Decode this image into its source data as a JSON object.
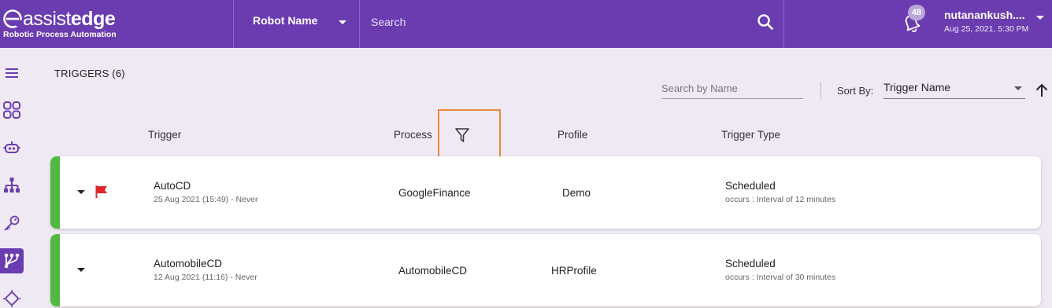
{
  "header": {
    "logo_assist": "assist",
    "logo_edge": "edge",
    "logo_subtitle": "Robotic Process Automation",
    "robot_select_label": "Robot Name",
    "search_placeholder": "Search",
    "notification_count": "48",
    "user_name": "nutanankush....",
    "user_datetime": "Aug 25, 2021, 5:30 PM"
  },
  "sidebar": {
    "items": [
      {
        "icon": "menu-icon"
      },
      {
        "icon": "dashboard-icon"
      },
      {
        "icon": "robot-icon"
      },
      {
        "icon": "hierarchy-icon"
      },
      {
        "icon": "key-icon"
      },
      {
        "icon": "workflow-icon",
        "active": true
      },
      {
        "icon": "chip-icon"
      }
    ]
  },
  "main": {
    "title": "TRIGGERS (6)",
    "search_by_name_placeholder": "Search by Name",
    "sort_by_label": "Sort By:",
    "sort_by_value": "Trigger Name",
    "columns": {
      "trigger": "Trigger",
      "process": "Process",
      "profile": "Profile",
      "trigger_type": "Trigger Type"
    },
    "rows": [
      {
        "name": "AutoCD",
        "date": "25 Aug 2021 (15:49) - Never",
        "process": "GoogleFinance",
        "profile": "Demo",
        "type": "Scheduled",
        "desc": "occurs : Interval of 12 minutes",
        "flagged": true
      },
      {
        "name": "AutomobileCD",
        "date": "12 Aug 2021 (11:16) - Never",
        "process": "AutomobileCD",
        "profile": "HRProfile",
        "type": "Scheduled",
        "desc": "occurs : Interval of 30 minutes",
        "flagged": false
      }
    ]
  },
  "colors": {
    "header_bg": "#6a3cb0",
    "page_bg": "#efe9f3",
    "status_green": "#52b842",
    "flag_red": "#e0262a",
    "highlight_orange": "#e98a3b"
  }
}
